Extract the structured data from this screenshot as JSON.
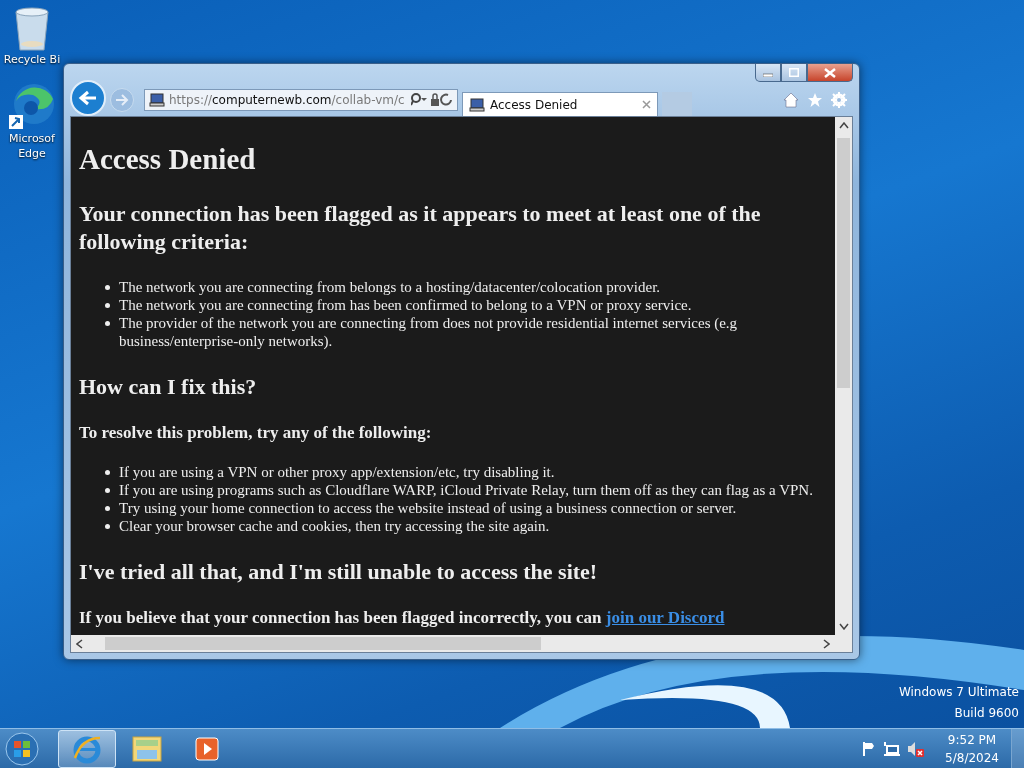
{
  "desktop_icons": [
    {
      "kind": "recycle-bin",
      "label": "Recycle Bi"
    },
    {
      "kind": "edge",
      "label": "Microsof Edge"
    }
  ],
  "browser": {
    "address": {
      "scheme": "https://",
      "host": "computernewb.com",
      "path": "/collab-vm/c"
    },
    "tabs": [
      {
        "title": "Access Denied",
        "selected": true
      }
    ],
    "page": [
      {
        "kind": "h1",
        "text": "Access Denied"
      },
      {
        "kind": "h2",
        "text": "Your connection has been flagged as it appears to meet at least one of the following criteria:"
      },
      {
        "kind": "list",
        "items": [
          "The network you are connecting from belongs to a hosting/datacenter/colocation provider.",
          "The network you are connecting from has been confirmed to belong to a VPN or proxy service.",
          "The provider of the network you are connecting from does not provide residential internet services (e.g business/enterprise-only networks)."
        ]
      },
      {
        "kind": "h2",
        "text": "How can I fix this?"
      },
      {
        "kind": "h3",
        "text": "To resolve this problem, try any of the following:"
      },
      {
        "kind": "list",
        "items": [
          "If you are using a VPN or other proxy app/extension/etc, try disabling it.",
          "If you are using programs such as Cloudflare WARP, iCloud Private Relay, turn them off as they can flag as a VPN.",
          "Try using your home connection to access the website instead of using a business connection or server.",
          "Clear your browser cache and cookies, then try accessing the site again."
        ]
      },
      {
        "kind": "h2",
        "text": "I've tried all that, and I'm still unable to access the site!"
      },
      {
        "kind": "h3",
        "text": "If you believe that your connection has been flagged incorrectly, you can",
        "link": "join our Discord"
      }
    ]
  },
  "os_watermark": [
    "Windows 7 Ultimate",
    "Build 9600"
  ],
  "taskbar": {
    "apps": [
      {
        "kind": "ie",
        "selected": true
      },
      {
        "kind": "explorer",
        "selected": false
      },
      {
        "kind": "media",
        "selected": false
      }
    ],
    "clock": {
      "time": "9:52 PM",
      "date": "5/8/2024"
    }
  }
}
